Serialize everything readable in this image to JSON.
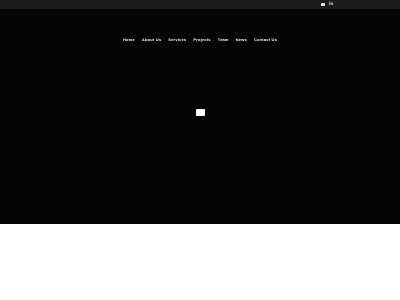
{
  "topbar": {
    "icons": [
      "mail-icon",
      "linkedin-icon"
    ],
    "linkedin_glyph": "in"
  },
  "nav": {
    "items": [
      "Home",
      "About Us",
      "Services",
      "Projects",
      "Team",
      "News",
      "Contact Us"
    ]
  },
  "colors": {
    "topbar_bg": "#1c1c1c",
    "hero_bg": "#040404",
    "nav_text": "#ffffff",
    "page_bg": "#ffffff"
  }
}
